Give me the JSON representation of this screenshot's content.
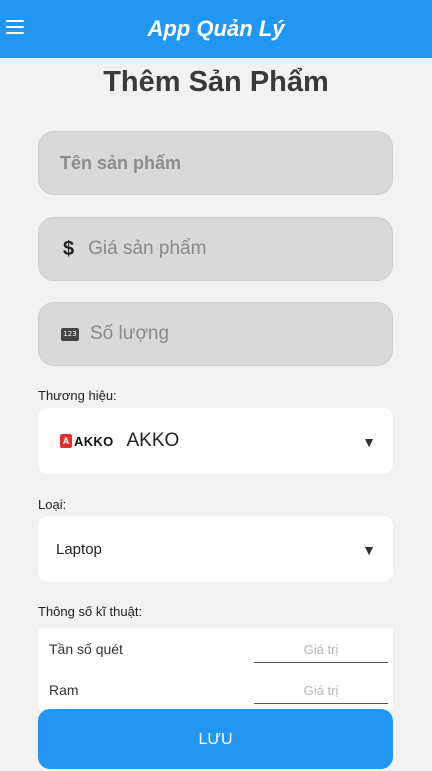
{
  "app_bar": {
    "title": "App Quản Lý",
    "menu_icon": "hamburger-menu-icon",
    "color": "#2196f3"
  },
  "page": {
    "title": "Thêm Sản Phẩm"
  },
  "form": {
    "name": {
      "placeholder": "Tên sản phẩm"
    },
    "price": {
      "placeholder": "Giá sản phẩm",
      "icon": "dollar-icon"
    },
    "quantity": {
      "placeholder": "Số lượng",
      "icon": "numpad-icon",
      "icon_text": "123"
    },
    "brand": {
      "label": "Thương hiệu:",
      "logo_text": "AKKO",
      "value": "AKKO",
      "logo_icon": "akko-logo-icon"
    },
    "type": {
      "label": "Loại:",
      "value": "Laptop"
    },
    "specs": {
      "label": "Thông số kĩ thuật:",
      "rows": [
        {
          "name": "Tần số quét",
          "placeholder": "Giá trị"
        },
        {
          "name": "Ram",
          "placeholder": "Giá trị"
        }
      ]
    },
    "save_label": "LƯU"
  },
  "dropdown_caret": "▼"
}
